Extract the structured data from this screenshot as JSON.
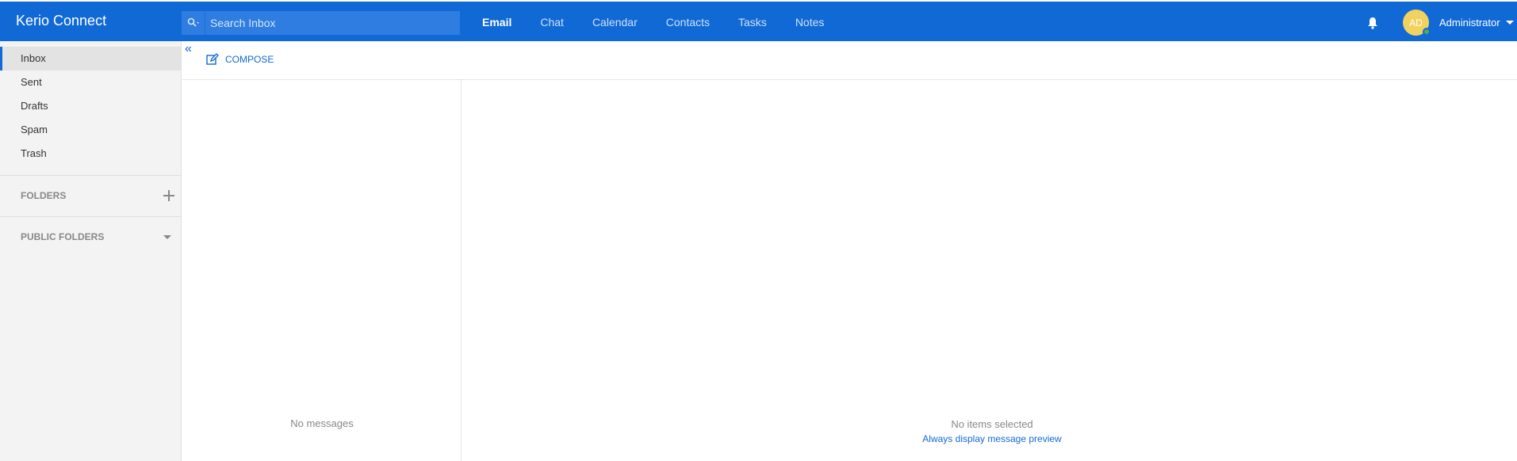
{
  "app": {
    "title": "Kerio Connect"
  },
  "search": {
    "placeholder": "Search Inbox"
  },
  "nav": {
    "items": [
      {
        "label": "Email",
        "active": true
      },
      {
        "label": "Chat"
      },
      {
        "label": "Calendar"
      },
      {
        "label": "Contacts"
      },
      {
        "label": "Tasks"
      },
      {
        "label": "Notes"
      }
    ]
  },
  "user": {
    "initials": "AD",
    "name": "Administrator",
    "status_color": "#4caf50"
  },
  "sidebar": {
    "items": [
      {
        "label": "Inbox",
        "active": true
      },
      {
        "label": "Sent"
      },
      {
        "label": "Drafts"
      },
      {
        "label": "Spam"
      },
      {
        "label": "Trash"
      }
    ],
    "folders_label": "FOLDERS",
    "public_folders_label": "PUBLIC FOLDERS"
  },
  "toolbar": {
    "compose_label": "COMPOSE"
  },
  "message_list": {
    "empty_text": "No messages"
  },
  "preview": {
    "empty_text": "No items selected",
    "link_text": "Always display message preview"
  },
  "colors": {
    "accent": "#1169d6",
    "topbar": "#1169d6",
    "avatar": "#f1d25f"
  }
}
